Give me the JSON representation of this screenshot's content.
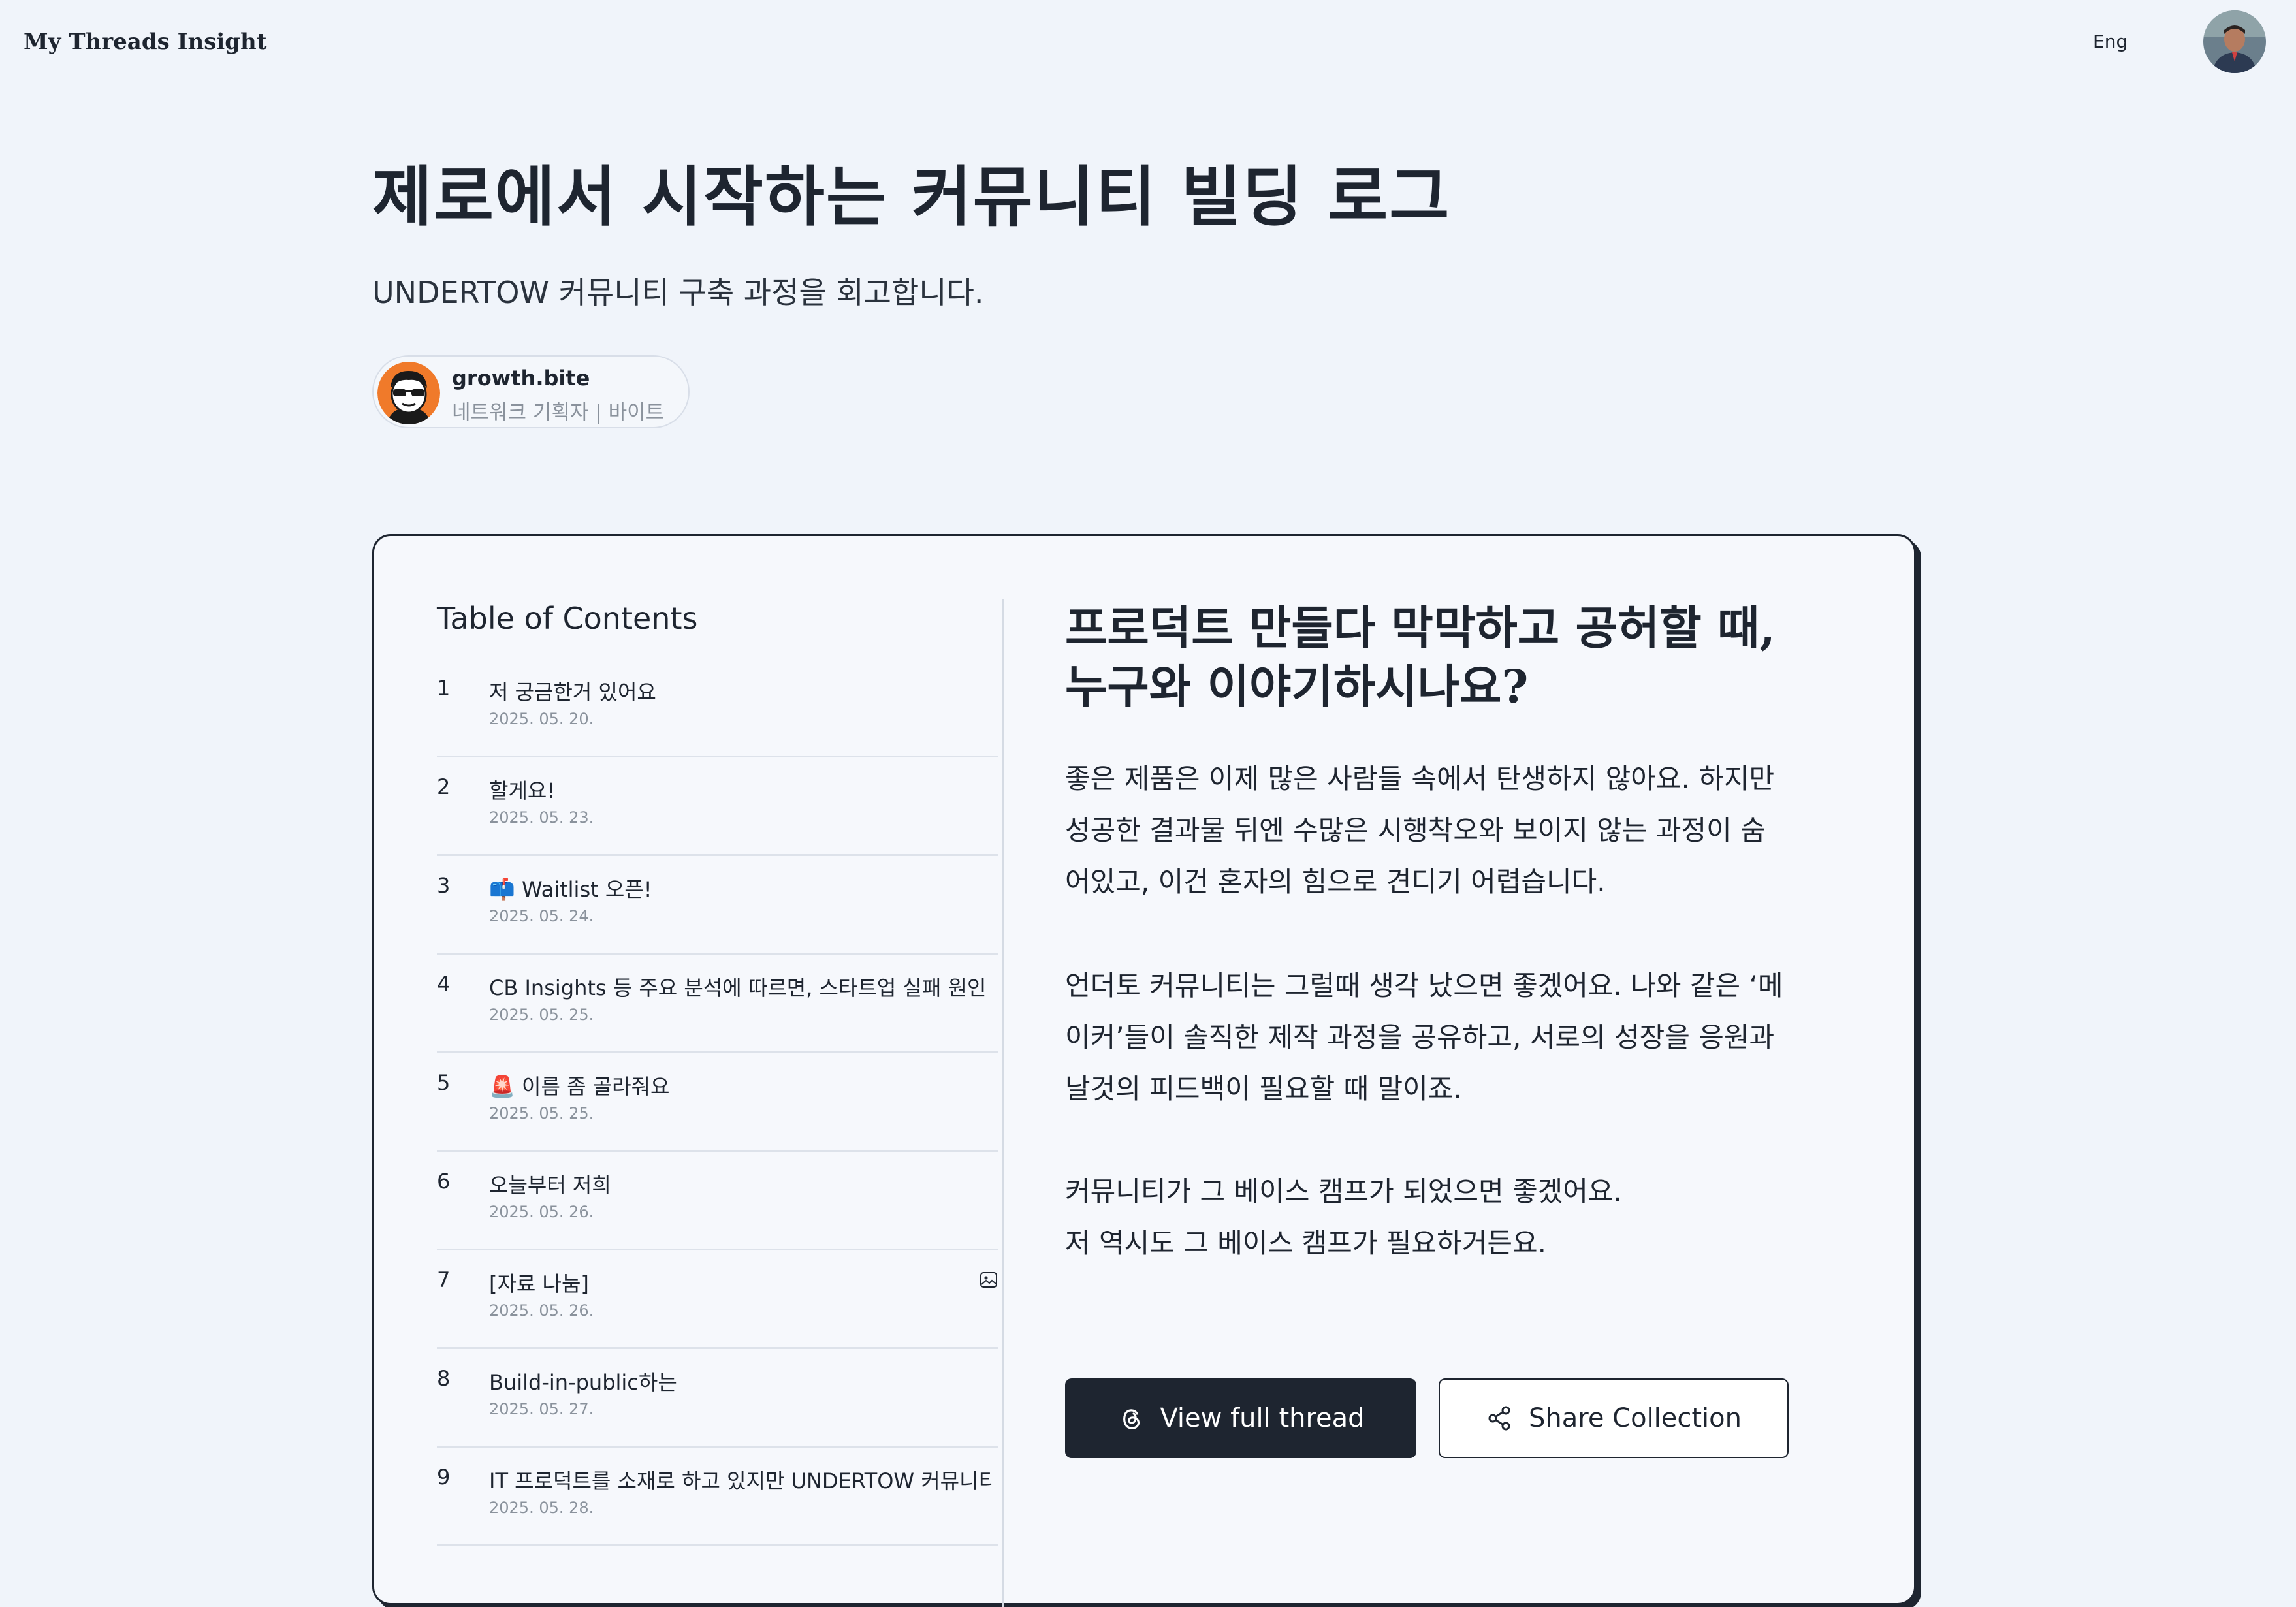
{
  "header": {
    "brand": "My Threads Insight",
    "language": "Eng"
  },
  "hero": {
    "title": "제로에서 시작하는 커뮤니티 빌딩 로그",
    "subtitle": "UNDERTOW 커뮤니티 구축 과정을 회고합니다."
  },
  "author": {
    "name": "growth.bite",
    "role": "네트워크 기획자 | 바이트"
  },
  "toc": {
    "title": "Table of Contents",
    "items": [
      {
        "num": "1",
        "label": "저 궁금한거 있어요",
        "date": "2025. 05. 20."
      },
      {
        "num": "2",
        "label": "할게요!",
        "date": "2025. 05. 23."
      },
      {
        "num": "3",
        "label": "📫 Waitlist 오픈!",
        "date": "2025. 05. 24."
      },
      {
        "num": "4",
        "label": "CB Insights 등 주요 분석에 따르면, 스타트업 실패 원인 중 가",
        "date": "2025. 05. 25."
      },
      {
        "num": "5",
        "label": "🚨 이름 좀 골라줘요",
        "date": "2025. 05. 25."
      },
      {
        "num": "6",
        "label": "오늘부터 저희",
        "date": "2025. 05. 26."
      },
      {
        "num": "7",
        "label": "[자료 나눔]",
        "date": "2025. 05. 26."
      },
      {
        "num": "8",
        "label": "Build-in-public하는",
        "date": "2025. 05. 27."
      },
      {
        "num": "9",
        "label": "IT 프로덕트를 소재로 하고 있지만 UNDERTOW 커뮤니티는",
        "date": "2025. 05. 28."
      }
    ]
  },
  "detail": {
    "title": "프로덕트 만들다 막막하고 공허할 때,\n누구와 이야기하시나요?",
    "paragraphs": [
      "좋은 제품은 이제 많은 사람들 속에서 탄생하지 않아요. 하지만\n성공한 결과물 뒤엔 수많은 시행착오와 보이지 않는 과정이 숨\n어있고, 이건 혼자의 힘으로 견디기 어렵습니다.",
      "언더토 커뮤니티는 그럴때 생각 났으면 좋겠어요. 나와 같은 ‘메\n이커’들이 솔직한 제작 과정을 공유하고, 서로의 성장을 응원과\n날것의 피드백이 필요할 때 말이죠.",
      "커뮤니티가 그 베이스 캠프가 되었으면 좋겠어요.\n저 역시도 그 베이스 캠프가 필요하거든요."
    ],
    "view_button": "View full thread",
    "share_button": "Share Collection"
  },
  "icons": {
    "threads": "threads-icon",
    "share": "share-icon",
    "image": "image-icon"
  }
}
